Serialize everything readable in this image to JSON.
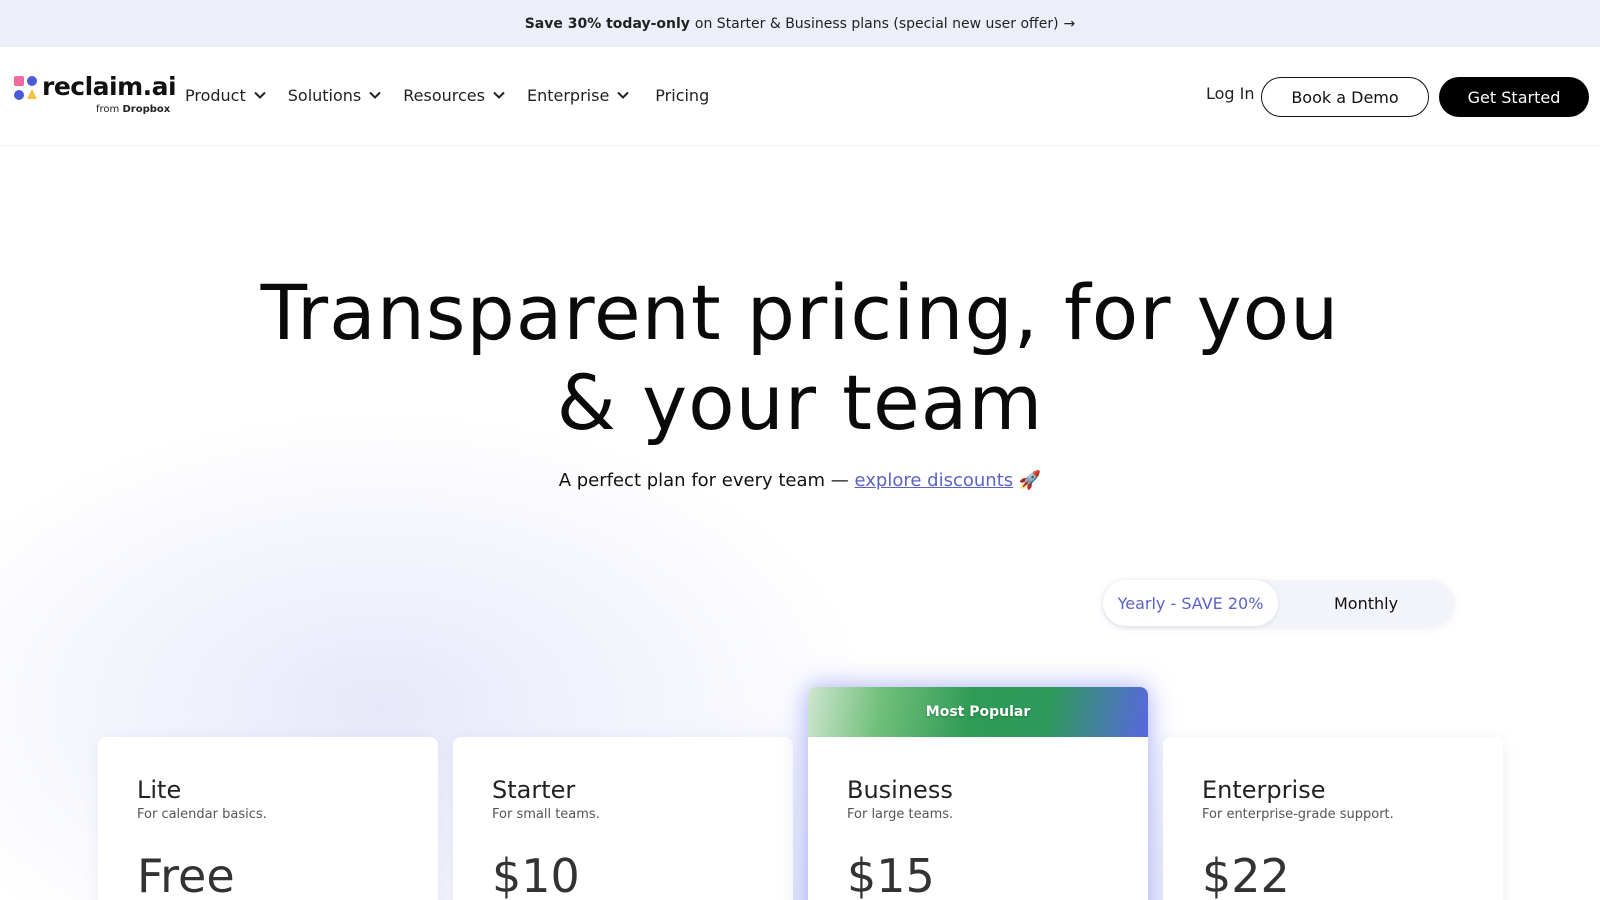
{
  "promo": {
    "strong": "Save 30% today-only",
    "text": "on Starter & Business plans (special new user offer)",
    "arrow": "→"
  },
  "nav": {
    "logo_word": "reclaim.ai",
    "logo_sub_prefix": "from",
    "logo_sub_brand": "Dropbox",
    "items": [
      {
        "label": "Product",
        "icon": "chevron-down-icon"
      },
      {
        "label": "Solutions",
        "icon": "chevron-down-icon"
      },
      {
        "label": "Resources",
        "icon": "chevron-down-icon"
      },
      {
        "label": "Enterprise",
        "icon": "chevron-down-icon"
      },
      {
        "label": "Pricing"
      }
    ],
    "login": "Log In",
    "demo": "Book a Demo",
    "start": "Get Started"
  },
  "hero": {
    "title_line1": "Transparent pricing, for you",
    "title_line2": "& your team",
    "sub_text": "A perfect plan for every team —",
    "sub_link": "explore discounts",
    "sub_emoji": "🚀"
  },
  "billing_toggle": {
    "yearly": "Yearly - SAVE 20%",
    "monthly": "Monthly",
    "selected": "yearly"
  },
  "plans": [
    {
      "name": "Lite",
      "desc": "For calendar basics.",
      "price": "Free"
    },
    {
      "name": "Starter",
      "desc": "For small teams.",
      "price": "$10"
    },
    {
      "name": "Business",
      "desc": "For large teams.",
      "price": "$15",
      "badge": "Most Popular"
    },
    {
      "name": "Enterprise",
      "desc": "For enterprise-grade support.",
      "price": "$22"
    }
  ],
  "colors": {
    "accent": "#5b63c6",
    "promo_bg": "#eceffa",
    "primary_button": "#000000",
    "logo_pink": "#f06aa0",
    "logo_yellow": "#f5c242",
    "logo_blue": "#4b5bd6"
  }
}
